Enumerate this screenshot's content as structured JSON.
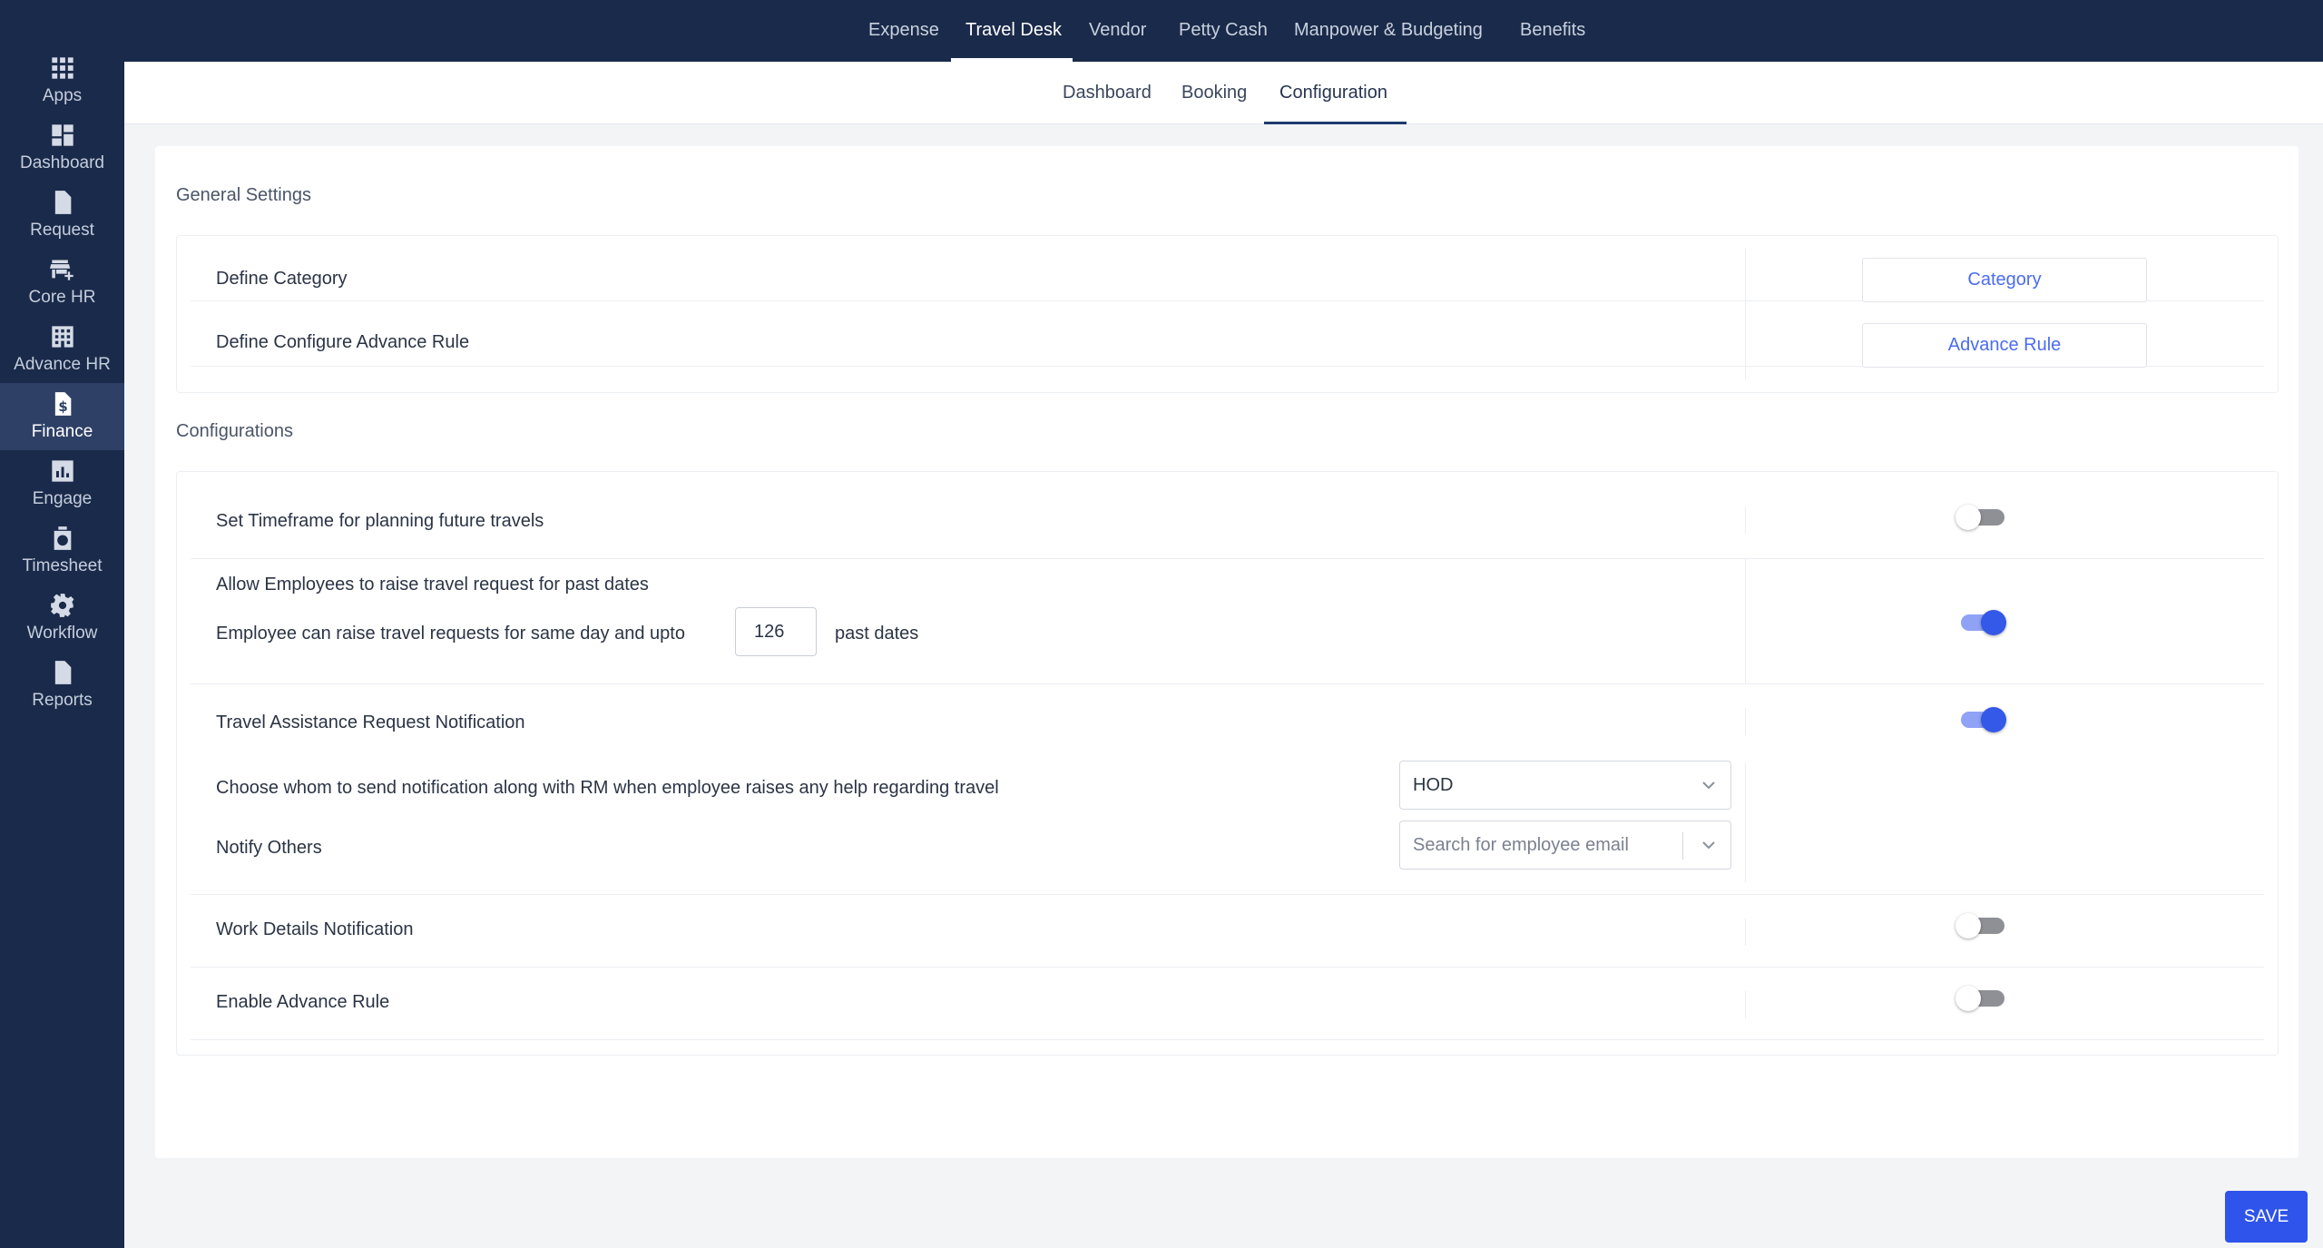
{
  "sidebar": {
    "items": [
      {
        "label": "Apps",
        "icon": "apps-grid-icon"
      },
      {
        "label": "Dashboard",
        "icon": "dashboard-icon"
      },
      {
        "label": "Request",
        "icon": "document-icon"
      },
      {
        "label": "Core HR",
        "icon": "store-add-icon"
      },
      {
        "label": "Advance HR",
        "icon": "building-icon"
      },
      {
        "label": "Finance",
        "icon": "dollar-file-icon"
      },
      {
        "label": "Engage",
        "icon": "bar-chart-icon"
      },
      {
        "label": "Timesheet",
        "icon": "stopwatch-icon"
      },
      {
        "label": "Workflow",
        "icon": "gear-icon"
      },
      {
        "label": "Reports",
        "icon": "report-icon"
      }
    ],
    "active": "Finance"
  },
  "topnav": {
    "tabs": [
      "Expense",
      "Travel Desk",
      "Vendor",
      "Petty Cash",
      "Manpower & Budgeting",
      "Benefits"
    ],
    "active": "Travel Desk"
  },
  "subnav": {
    "tabs": [
      "Dashboard",
      "Booking",
      "Configuration"
    ],
    "active": "Configuration"
  },
  "general_settings": {
    "title": "General Settings",
    "rows": [
      {
        "label": "Define Category",
        "button": "Category"
      },
      {
        "label": "Define Configure Advance Rule",
        "button": "Advance Rule"
      }
    ]
  },
  "configurations": {
    "title": "Configurations",
    "timeframe": {
      "label": "Set Timeframe for planning future travels",
      "enabled": false
    },
    "past_dates": {
      "label": "Allow Employees to raise travel request for past dates",
      "sub_prefix": "Employee can raise travel requests for same day and upto",
      "value": "126",
      "sub_suffix": "past dates",
      "enabled": true
    },
    "assistance": {
      "label": "Travel Assistance Request Notification",
      "enabled": true,
      "whom_label": "Choose whom to send notification along with RM when employee raises any help regarding travel",
      "whom_value": "HOD",
      "notify_label": "Notify Others",
      "notify_placeholder": "Search for employee email"
    },
    "work_details": {
      "label": "Work Details Notification",
      "enabled": false
    },
    "advance_rule": {
      "label": "Enable Advance Rule",
      "enabled": false
    }
  },
  "save_label": "SAVE",
  "colors": {
    "nav_bg": "#1a2a4a",
    "accent": "#2f54eb",
    "link": "#4a6cf0"
  }
}
